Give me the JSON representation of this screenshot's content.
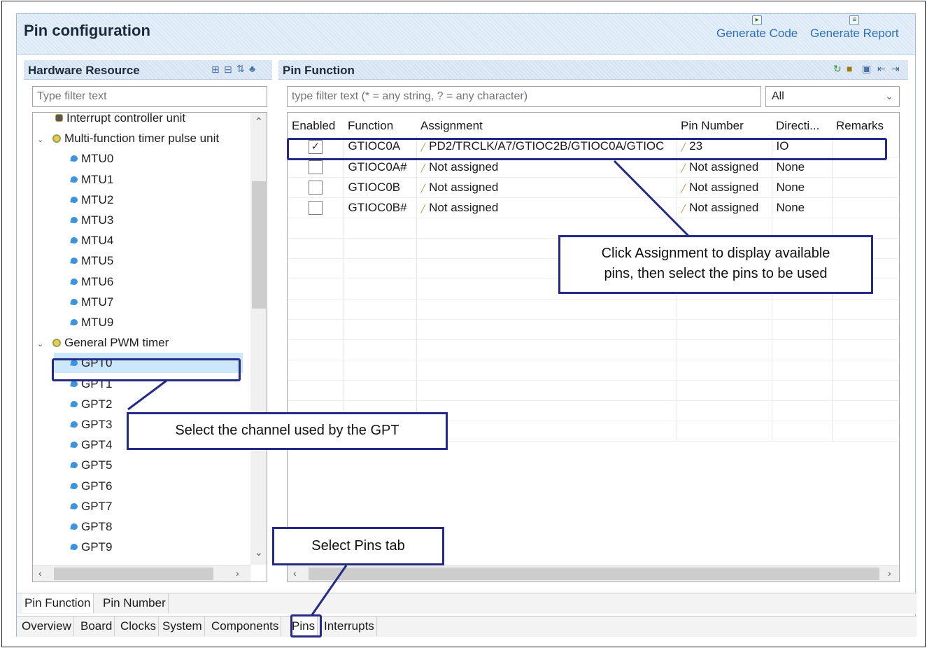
{
  "editor": {
    "title": "Pin configuration",
    "generate_code_label": "Generate Code",
    "generate_report_label": "Generate Report"
  },
  "hardware_panel": {
    "title": "Hardware Resource",
    "filter_placeholder": "Type filter text",
    "tree": [
      {
        "label": "Interrupt controller unit",
        "icon": "chip-icon",
        "level": 0,
        "expanded": null
      },
      {
        "label": "Multi-function timer pulse unit",
        "icon": "group-icon",
        "level": 0,
        "expanded": true
      },
      {
        "label": "MTU0",
        "icon": "leaf-icon",
        "level": 1
      },
      {
        "label": "MTU1",
        "icon": "leaf-icon",
        "level": 1
      },
      {
        "label": "MTU2",
        "icon": "leaf-icon",
        "level": 1
      },
      {
        "label": "MTU3",
        "icon": "leaf-icon",
        "level": 1
      },
      {
        "label": "MTU4",
        "icon": "leaf-icon",
        "level": 1
      },
      {
        "label": "MTU5",
        "icon": "leaf-icon",
        "level": 1
      },
      {
        "label": "MTU6",
        "icon": "leaf-icon",
        "level": 1
      },
      {
        "label": "MTU7",
        "icon": "leaf-icon",
        "level": 1
      },
      {
        "label": "MTU9",
        "icon": "leaf-icon",
        "level": 1
      },
      {
        "label": "General PWM timer",
        "icon": "group-icon",
        "level": 0,
        "expanded": true
      },
      {
        "label": "GPT0",
        "icon": "leaf-icon",
        "level": 1,
        "selected": true
      },
      {
        "label": "GPT1",
        "icon": "leaf-icon",
        "level": 1
      },
      {
        "label": "GPT2",
        "icon": "leaf-icon",
        "level": 1
      },
      {
        "label": "GPT3",
        "icon": "leaf-icon",
        "level": 1
      },
      {
        "label": "GPT4",
        "icon": "leaf-icon",
        "level": 1
      },
      {
        "label": "GPT5",
        "icon": "leaf-icon",
        "level": 1
      },
      {
        "label": "GPT6",
        "icon": "leaf-icon",
        "level": 1
      },
      {
        "label": "GPT7",
        "icon": "leaf-icon",
        "level": 1
      },
      {
        "label": "GPT8",
        "icon": "leaf-icon",
        "level": 1
      },
      {
        "label": "GPT9",
        "icon": "leaf-icon",
        "level": 1
      }
    ]
  },
  "pin_function_panel": {
    "title": "Pin Function",
    "filter_placeholder": "type filter text (* = any string, ? = any character)",
    "combo_value": "All",
    "columns": [
      "Enabled",
      "Function",
      "Assignment",
      "Pin Number",
      "Directi...",
      "Remarks"
    ],
    "rows": [
      {
        "enabled": true,
        "function": "GTIOC0A",
        "assignment": "PD2/TRCLK/A7/GTIOC2B/GTIOC0A/GTIOC",
        "pin_number": "23",
        "direction": "IO",
        "remarks": ""
      },
      {
        "enabled": false,
        "function": "GTIOC0A#",
        "assignment": "Not assigned",
        "pin_number": "Not assigned",
        "direction": "None",
        "remarks": ""
      },
      {
        "enabled": false,
        "function": "GTIOC0B",
        "assignment": "Not assigned",
        "pin_number": "Not assigned",
        "direction": "None",
        "remarks": ""
      },
      {
        "enabled": false,
        "function": "GTIOC0B#",
        "assignment": "Not assigned",
        "pin_number": "Not assigned",
        "direction": "None",
        "remarks": ""
      }
    ]
  },
  "bottom_tabs": {
    "view_tabs": [
      "Pin Function",
      "Pin Number"
    ],
    "editor_tabs": [
      "Overview",
      "Board",
      "Clocks",
      "System",
      "Components",
      "Pins",
      "Interrupts"
    ]
  },
  "callouts": {
    "assignment_note": "Click Assignment to display available pins, then select the pins to be used",
    "assignment_line1": "Click Assignment to display available",
    "assignment_line2": "pins, then select the pins to be used",
    "channel_note": "Select the channel used by the GPT",
    "pins_tab_note": "Select Pins tab"
  },
  "colors": {
    "callout_border": "#252a84",
    "link_blue": "#2b6fc2",
    "selection": "#cce7fb"
  }
}
